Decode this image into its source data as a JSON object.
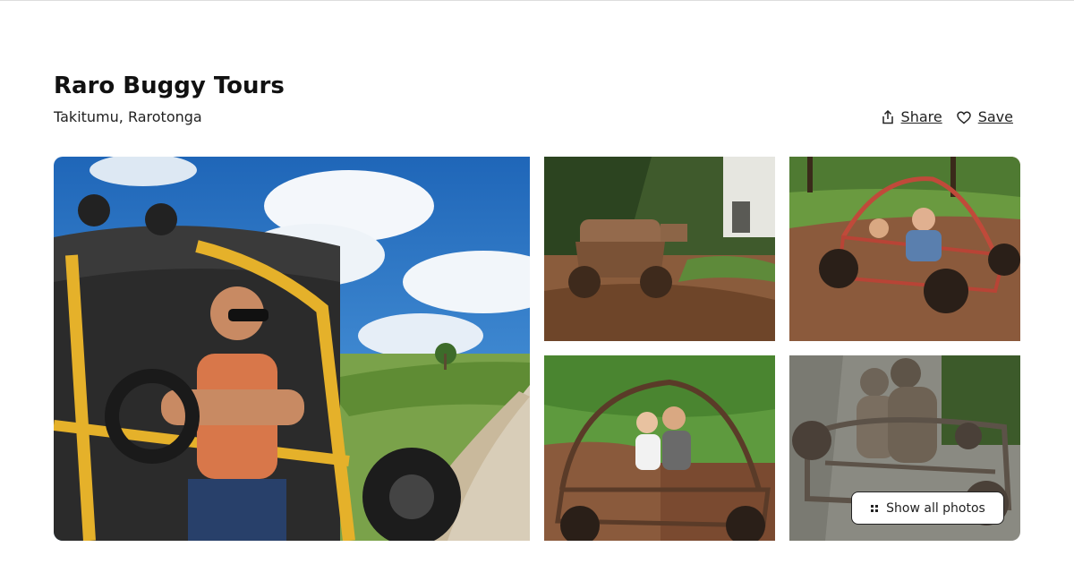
{
  "listing": {
    "title": "Raro Buggy Tours",
    "location": "Takitumu, Rarotonga"
  },
  "actions": {
    "share_label": "Share",
    "save_label": "Save",
    "share_icon": "share-icon",
    "save_icon": "heart-icon"
  },
  "gallery": {
    "show_all_label": "Show all photos",
    "show_all_icon": "grid-dots-icon",
    "photos": [
      "photo-main-yellow-buggy-driver",
      "photo-muddy-buggy-puddle",
      "photo-red-frame-buggy-dirt",
      "photo-two-women-buggy-grass",
      "photo-mud-covered-riders"
    ]
  },
  "colors": {
    "text": "#222222",
    "border": "#dddddd",
    "background": "#ffffff"
  }
}
